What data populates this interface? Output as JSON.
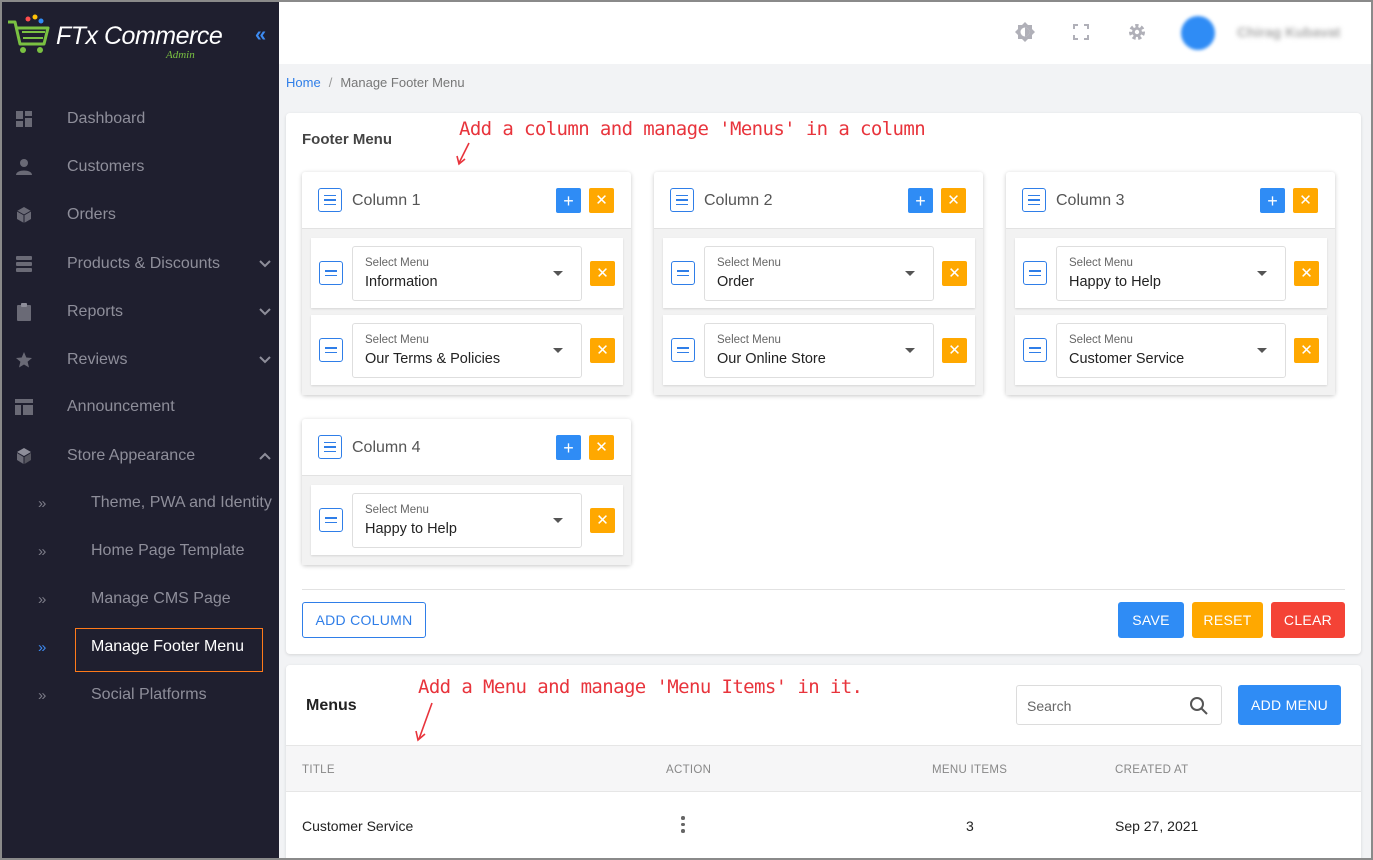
{
  "app": {
    "logo_text": "FTx Commerce",
    "logo_sub": "Admin",
    "collapse_icon": "double-chevron-left-icon"
  },
  "sidebar": {
    "items": [
      {
        "label": "Dashboard",
        "icon": "dashboard-icon"
      },
      {
        "label": "Customers",
        "icon": "user-icon"
      },
      {
        "label": "Orders",
        "icon": "box-icon"
      },
      {
        "label": "Products & Discounts",
        "icon": "products-icon",
        "expandable": true
      },
      {
        "label": "Reports",
        "icon": "clipboard-icon",
        "expandable": true
      },
      {
        "label": "Reviews",
        "icon": "star-icon",
        "expandable": true
      },
      {
        "label": "Announcement",
        "icon": "announcement-icon"
      },
      {
        "label": "Store Appearance",
        "icon": "cube-icon",
        "expanded": true
      }
    ],
    "sub_items": [
      {
        "label": "Theme, PWA and Identity"
      },
      {
        "label": "Home Page Template"
      },
      {
        "label": "Manage CMS Page"
      },
      {
        "label": "Manage Footer Menu",
        "active": true
      },
      {
        "label": "Social Platforms"
      }
    ]
  },
  "header": {
    "icons": [
      "brightness-icon",
      "fullscreen-icon",
      "gear-icon"
    ],
    "user_name": "Chirag Kubavat"
  },
  "breadcrumb": {
    "home": "Home",
    "separator": "/",
    "current": "Manage Footer Menu"
  },
  "footer_menu": {
    "title": "Footer Menu",
    "annotation": "Add a column and manage 'Menus' in a column",
    "select_label": "Select Menu",
    "columns": [
      {
        "label": "Column 1",
        "menus": [
          "Information",
          "Our Terms & Policies"
        ]
      },
      {
        "label": "Column 2",
        "menus": [
          "Order",
          "Our Online Store"
        ]
      },
      {
        "label": "Column 3",
        "menus": [
          "Happy to Help",
          "Customer Service"
        ]
      },
      {
        "label": "Column 4",
        "menus": [
          "Happy to Help"
        ]
      }
    ],
    "add_column_label": "ADD COLUMN",
    "save_label": "SAVE",
    "reset_label": "RESET",
    "clear_label": "CLEAR"
  },
  "menus": {
    "title": "Menus",
    "annotation": "Add a Menu and manage 'Menu Items' in it.",
    "search_placeholder": "Search",
    "add_menu_label": "ADD MENU",
    "columns": [
      "TITLE",
      "ACTION",
      "MENU ITEMS",
      "CREATED AT"
    ],
    "rows": [
      {
        "title": "Customer Service",
        "menu_items": "3",
        "created_at": "Sep 27, 2021"
      }
    ]
  },
  "colors": {
    "sidebar_bg": "#1f1f2f",
    "primary": "#2f8cf5",
    "warning": "#ffa800",
    "danger": "#f44336",
    "annotation": "#e8343c",
    "active_outline": "#ff7a1a"
  }
}
